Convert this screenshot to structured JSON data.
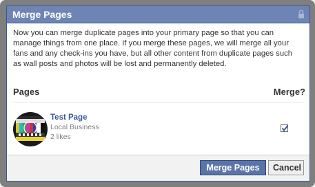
{
  "dialog": {
    "title": "Merge Pages",
    "intro": "Now you can merge duplicate pages into your primary page so that you can manage things from one place. If you merge these pages, we will merge all your fans and any check-ins you have, but all other content from duplicate pages such as wall posts and photos will be lost and permanently deleted."
  },
  "columns": {
    "pages": "Pages",
    "merge": "Merge?"
  },
  "pages": [
    {
      "name": "Test Page",
      "category": "Local Business",
      "likes": "2 likes",
      "merge_checked": true
    }
  ],
  "buttons": {
    "merge": "Merge Pages",
    "cancel": "Cancel"
  },
  "colors": {
    "header": "#6d84b4",
    "link": "#3b5998",
    "primary_button": "#5b74a8"
  },
  "icons": [
    "lock-icon",
    "checkbox-checked-icon"
  ]
}
